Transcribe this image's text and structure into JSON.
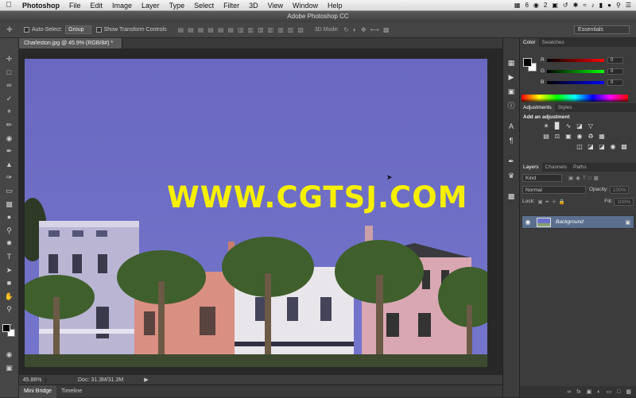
{
  "menubar": {
    "app": "Photoshop",
    "items": [
      "File",
      "Edit",
      "Image",
      "Layer",
      "Type",
      "Select",
      "Filter",
      "3D",
      "View",
      "Window",
      "Help"
    ],
    "status": {
      "badge1": "6",
      "badge2": "2"
    }
  },
  "window": {
    "title": "Adobe Photoshop CC"
  },
  "options": {
    "auto_select_label": "Auto-Select:",
    "auto_select_value": "Group",
    "show_transform_label": "Show Transform Controls",
    "mode_3d_label": "3D Mode:",
    "workspace": "Essentials"
  },
  "document": {
    "tab_title": "Charleston.jpg @ 45.9% (RGB/8#) *",
    "watermark": "WWW.CGTSJ.COM",
    "zoom": "45.88%",
    "doc_info": "Doc: 31.3M/31.3M"
  },
  "bottom_tabs": [
    {
      "label": "Mini Bridge"
    },
    {
      "label": "Timeline"
    }
  ],
  "color_panel": {
    "tabs": [
      "Color",
      "Swatches"
    ],
    "r_label": "R",
    "g_label": "G",
    "b_label": "B",
    "r_value": "0",
    "g_value": "0",
    "b_value": "0"
  },
  "adjustments_panel": {
    "tabs": [
      "Adjustments",
      "Styles"
    ],
    "title": "Add an adjustment"
  },
  "layers_panel": {
    "tabs": [
      "Layers",
      "Channels",
      "Paths"
    ],
    "filter_label": "Kind",
    "blend_mode": "Normal",
    "opacity_label": "Opacity:",
    "opacity_value": "100%",
    "lock_label": "Lock:",
    "fill_label": "Fill:",
    "fill_value": "100%",
    "layer_name": "Background"
  },
  "colors": {
    "accent_layer": "#5b6f8e",
    "watermark": "#f6f000",
    "sky": "#6e6fc4"
  }
}
